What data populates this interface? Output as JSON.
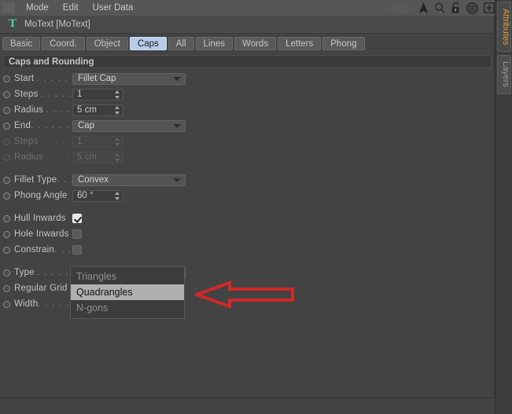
{
  "menubar": {
    "grip": "drag-grip",
    "items": [
      "Mode",
      "Edit",
      "User Data"
    ],
    "icons": [
      "wireframe-icon",
      "cursor-arrow-icon",
      "search-icon",
      "lock-icon",
      "target-icon",
      "plus-box-icon"
    ]
  },
  "object": {
    "icon": "T",
    "title": "MoText [MoText]"
  },
  "tabs": [
    {
      "label": "Basic",
      "active": false
    },
    {
      "label": "Coord.",
      "active": false
    },
    {
      "label": "Object",
      "active": false
    },
    {
      "label": "Caps",
      "active": true
    },
    {
      "label": "All",
      "active": false
    },
    {
      "label": "Lines",
      "active": false
    },
    {
      "label": "Words",
      "active": false
    },
    {
      "label": "Letters",
      "active": false
    },
    {
      "label": "Phong",
      "active": false
    }
  ],
  "section": {
    "title": "Caps and Rounding"
  },
  "params": {
    "start_label": "Start",
    "start_dots": ". . . . . . .",
    "start_value": "Fillet Cap",
    "steps1_label": "Steps",
    "steps1_dots": ". . . . . .",
    "steps1_value": "1",
    "radius1_label": "Radius",
    "radius1_dots": ". . . . .",
    "radius1_value": "5 cm",
    "end_label": "End",
    "end_dots": ". . . . . . . .",
    "end_value": "Cap",
    "steps2_label": "Steps",
    "steps2_dots": ". . . . . .",
    "steps2_value": "1",
    "radius2_label": "Radius",
    "radius2_dots": ". . . . .",
    "radius2_value": "5 cm",
    "fillet_type_label": "Fillet Type",
    "fillet_type_dots": ". . .",
    "fillet_type_value": "Convex",
    "phong_angle_label": "Phong Angle",
    "phong_angle_dots": "",
    "phong_angle_value": "60 °",
    "hull_inwards_label": "Hull Inwards",
    "hole_inwards_label": "Hole Inwards",
    "constrain_label": "Constrain",
    "constrain_dots": ". . .",
    "type_label": "Type",
    "type_dots": ". . . . . . .",
    "type_value": "Quadrangles",
    "regular_grid_label": "Regular Grid",
    "width_label": "Width",
    "width_dots": ". . . . . ."
  },
  "dropdown": {
    "options": [
      "Triangles",
      "Quadrangles",
      "N-gons"
    ],
    "highlighted": "Quadrangles"
  },
  "dock": {
    "attributes_label": "Attributes",
    "layers_label": "Layers"
  },
  "annotation": {
    "arrow": "left-pointing-arrow",
    "color": "#d32828"
  },
  "colors": {
    "panel_bg": "#434343",
    "menubar_bg": "#565656",
    "active_tab_bg": "#b6ccea",
    "accent_orange": "#e0a03c",
    "object_icon_green": "#4cd69a",
    "annotation_red": "#d32828"
  }
}
